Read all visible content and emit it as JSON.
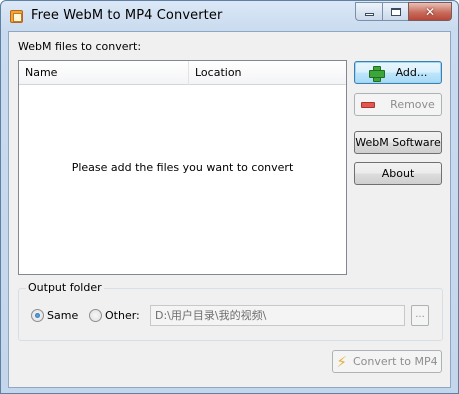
{
  "window": {
    "title": "Free WebM to MP4 Converter",
    "icon": "app-icon"
  },
  "files": {
    "label": "WebM files to convert:",
    "columns": [
      "Name",
      "Location"
    ],
    "empty_message": "Please add the files you want to convert",
    "rows": []
  },
  "buttons": {
    "add": "Add...",
    "remove": "Remove",
    "webm_software": "WebM Software",
    "about": "About",
    "convert": "Convert to MP4",
    "browse": "..."
  },
  "output": {
    "group_title": "Output folder",
    "same_label": "Same",
    "other_label": "Other:",
    "selected": "Same",
    "path_value": "D:\\用户目录\\我的视频\\"
  }
}
